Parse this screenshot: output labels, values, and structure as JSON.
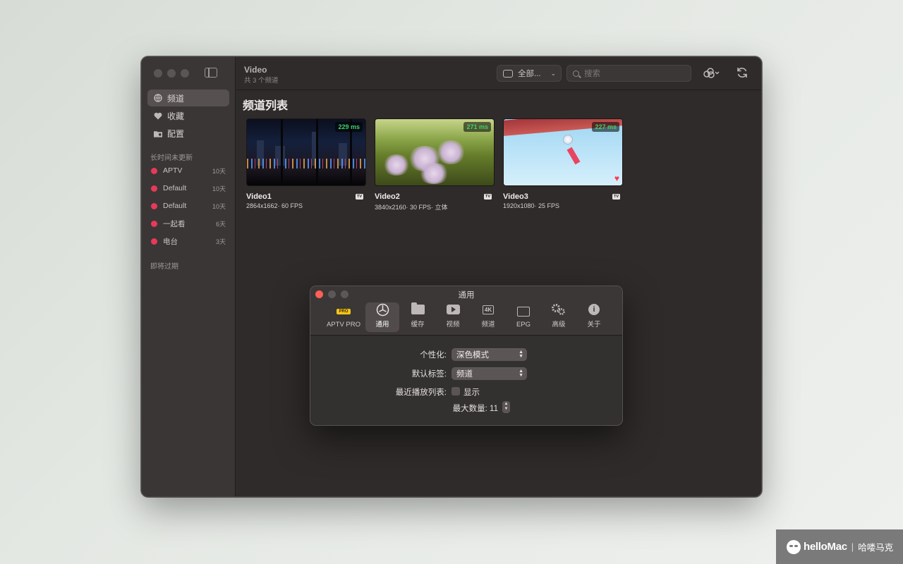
{
  "sidebar": {
    "nav": [
      {
        "label": "频道",
        "icon": "globe-icon",
        "active": true
      },
      {
        "label": "收藏",
        "icon": "heart-icon",
        "active": false
      },
      {
        "label": "配置",
        "icon": "folder-gear-icon",
        "active": false
      }
    ],
    "section_stale": "长时间未更新",
    "channels": [
      {
        "name": "APTV",
        "age": "10天"
      },
      {
        "name": "Default",
        "age": "10天"
      },
      {
        "name": "Default",
        "age": "10天"
      },
      {
        "name": "一起看",
        "age": "6天"
      },
      {
        "name": "电台",
        "age": "3天"
      }
    ],
    "section_expiring": "即将过期"
  },
  "toolbar": {
    "title": "Video",
    "subtitle": "共 3 个频道",
    "filter_label": "全部...",
    "search_placeholder": "搜索"
  },
  "main": {
    "heading": "频道列表",
    "channels": [
      {
        "title": "Video1",
        "meta": "2864x1662· 60 FPS",
        "latency": "229 ms",
        "badge": "TV",
        "favorite": false
      },
      {
        "title": "Video2",
        "meta": "3840x2160· 30 FPS· 立体",
        "latency": "271 ms",
        "badge": "TV",
        "favorite": false
      },
      {
        "title": "Video3",
        "meta": "1920x1080· 25 FPS",
        "latency": "227 ms",
        "badge": "TV",
        "favorite": true
      }
    ]
  },
  "prefs": {
    "title": "通用",
    "tabs": [
      {
        "label": "APTV PRO",
        "badge": "PRO",
        "active": false
      },
      {
        "label": "通用",
        "active": true
      },
      {
        "label": "缓存",
        "active": false
      },
      {
        "label": "视频",
        "active": false
      },
      {
        "label": "频道",
        "icon_text": "4K",
        "active": false
      },
      {
        "label": "EPG",
        "active": false
      },
      {
        "label": "高级",
        "active": false
      },
      {
        "label": "关于",
        "active": false
      }
    ],
    "personalization_label": "个性化:",
    "personalization_value": "深色模式",
    "default_tab_label": "默认标签:",
    "default_tab_value": "频道",
    "recent_label": "最近播放列表:",
    "recent_checkbox_label": "显示",
    "recent_checked": false,
    "max_count_label": "最大数量: 11"
  },
  "watermark": {
    "brand": "helloMac",
    "separator": "|",
    "cn": "哈喽马克"
  }
}
